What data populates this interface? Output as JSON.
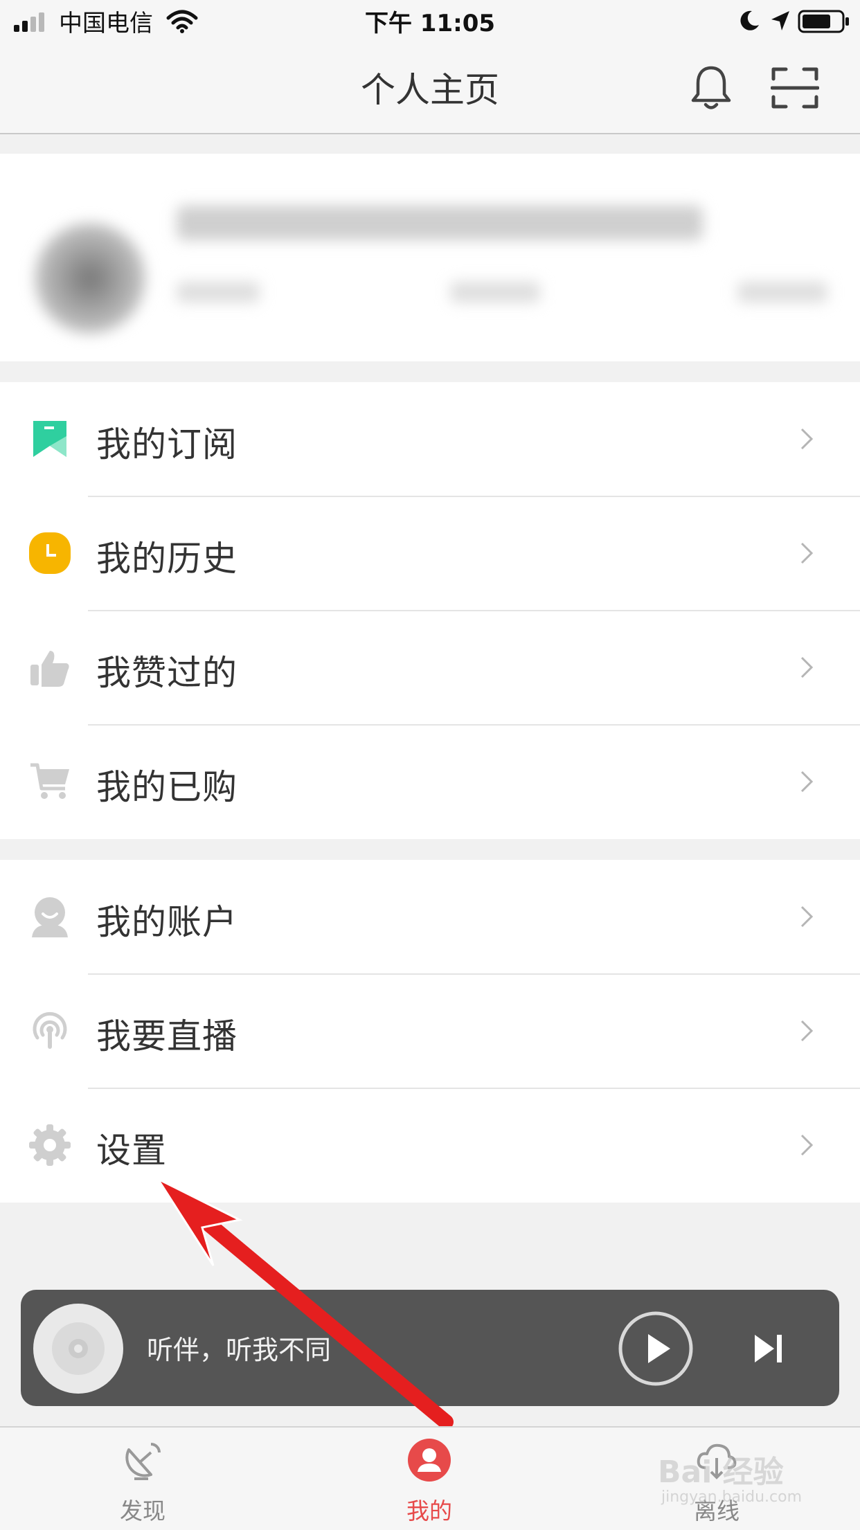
{
  "status_bar": {
    "carrier": "中国电信",
    "time": "下午 11:05"
  },
  "nav": {
    "title": "个人主页",
    "bell_icon": "bell-icon",
    "scan_icon": "scan-icon"
  },
  "menu_group_1": [
    {
      "label": "我的订阅",
      "icon": "bookmark-icon"
    },
    {
      "label": "我的历史",
      "icon": "clock-icon"
    },
    {
      "label": "我赞过的",
      "icon": "thumbs-up-icon"
    },
    {
      "label": "我的已购",
      "icon": "cart-icon"
    }
  ],
  "menu_group_2": [
    {
      "label": "我的账户",
      "icon": "account-icon"
    },
    {
      "label": "我要直播",
      "icon": "broadcast-icon"
    },
    {
      "label": "设置",
      "icon": "gear-icon"
    }
  ],
  "player": {
    "text": "听伴，听我不同"
  },
  "tabs": [
    {
      "label": "发现",
      "icon": "satellite-dish-icon"
    },
    {
      "label": "我的",
      "icon": "user-icon",
      "active": true
    },
    {
      "label": "离线",
      "icon": "cloud-download-icon"
    }
  ],
  "watermark": {
    "text": "Bai 经验",
    "url": "jingyan.baidu.com"
  },
  "colors": {
    "accent": "#e74a4a",
    "subscription_teal": "#2fcf9f",
    "history_yellow": "#f7b500",
    "player_bg": "#555555",
    "arrow_red": "#e51f1f"
  }
}
